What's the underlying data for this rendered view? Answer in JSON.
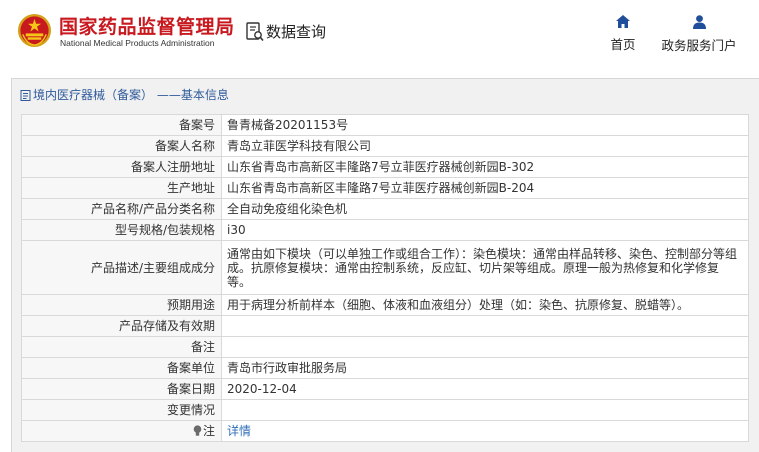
{
  "header": {
    "brand_cn": "国家药品监督管理局",
    "brand_en": "National Medical Products Administration",
    "query_label": "数据查询",
    "nav": {
      "home": "首页",
      "service": "政务服务门户"
    }
  },
  "breadcrumb": "境内医疗器械（备案） ——基本信息",
  "colors": {
    "brand_red": "#c8191f",
    "link_blue": "#2f6fb8",
    "nav_icon": "#1f4e9b"
  },
  "rows": [
    {
      "label": "备案号",
      "value": "鲁青械备20201153号"
    },
    {
      "label": "备案人名称",
      "value": "青岛立菲医学科技有限公司"
    },
    {
      "label": "备案人注册地址",
      "value": "山东省青岛市高新区丰隆路7号立菲医疗器械创新园B-302"
    },
    {
      "label": "生产地址",
      "value": "山东省青岛市高新区丰隆路7号立菲医疗器械创新园B-204"
    },
    {
      "label": "产品名称/产品分类名称",
      "value": "全自动免疫组化染色机"
    },
    {
      "label": "型号规格/包装规格",
      "value": "i30"
    },
    {
      "label": "产品描述/主要组成成分",
      "value": "通常由如下模块（可以单独工作或组合工作）：染色模块：通常由样品转移、染色、控制部分等组成。抗原修复模块：通常由控制系统，反应缸、切片架等组成。原理一般为热修复和化学修复等。"
    },
    {
      "label": "预期用途",
      "value": "用于病理分析前样本（细胞、体液和血液组分）处理（如：染色、抗原修复、脱蜡等）。"
    },
    {
      "label": "产品存储及有效期",
      "value": ""
    },
    {
      "label": "备注",
      "value": ""
    },
    {
      "label": "备案单位",
      "value": "青岛市行政审批服务局"
    },
    {
      "label": "备案日期",
      "value": "2020-12-04"
    },
    {
      "label": "变更情况",
      "value": ""
    },
    {
      "label": "注",
      "value": "详情"
    }
  ]
}
